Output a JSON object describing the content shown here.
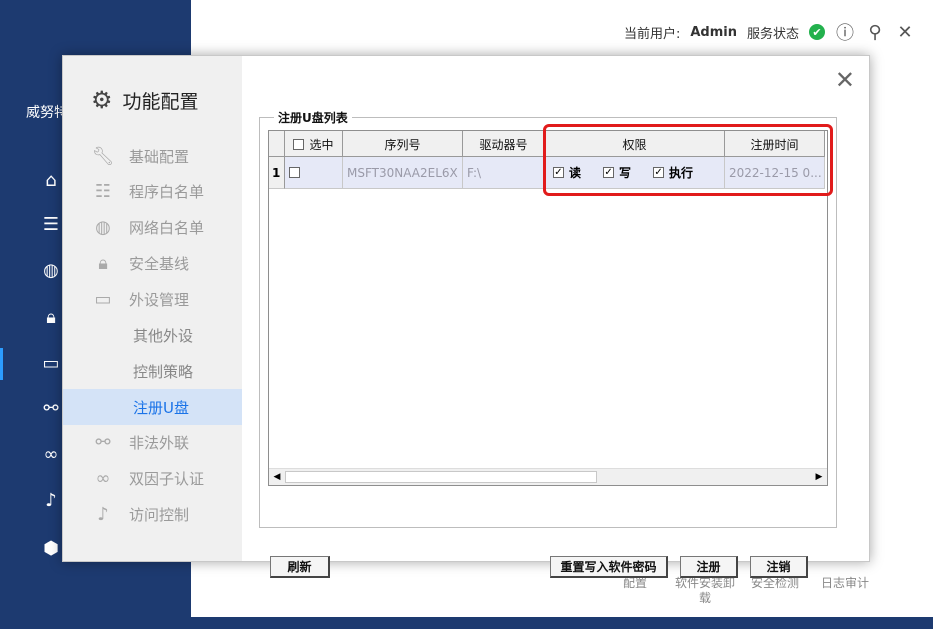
{
  "app": {
    "brand": "威努特",
    "current_user_label": "当前用户:",
    "current_user": "Admin",
    "service_status_label": "服务状态"
  },
  "bottom_tabs": [
    "配置",
    "软件安装卸载",
    "安全检测",
    "日志审计"
  ],
  "dialog": {
    "title": "功能配置",
    "nav": [
      {
        "label": "基础配置",
        "icon": "wrench-icon"
      },
      {
        "label": "程序白名单",
        "icon": "program-list-icon"
      },
      {
        "label": "网络白名单",
        "icon": "globe-icon"
      },
      {
        "label": "安全基线",
        "icon": "lock-icon"
      },
      {
        "label": "外设管理",
        "icon": "monitor-icon"
      },
      {
        "label": "其他外设",
        "icon": ""
      },
      {
        "label": "控制策略",
        "icon": ""
      },
      {
        "label": "注册U盘",
        "icon": ""
      },
      {
        "label": "非法外联",
        "icon": "broken-link-icon"
      },
      {
        "label": "双因子认证",
        "icon": "double-ring-icon"
      },
      {
        "label": "访问控制",
        "icon": "microphone-icon"
      }
    ],
    "active_nav": "注册U盘",
    "group_title": "注册U盘列表",
    "table": {
      "headers": [
        "选中",
        "序列号",
        "驱动器号",
        "权限",
        "注册时间"
      ],
      "rows": [
        {
          "num": "1",
          "serial": "MSFT30NAA2EL6X",
          "drive": "F:\\",
          "perm_read": "读",
          "perm_write": "写",
          "perm_exec": "执行",
          "time": "2022-12-15 0..."
        }
      ]
    },
    "buttons": {
      "refresh": "刷新",
      "reset_password": "重置写入软件密码",
      "register": "注册",
      "unregister": "注销"
    }
  },
  "colors": {
    "sidebar": "#1d3a70",
    "highlight": "#e11b1b",
    "active_nav": "#d4e3f7",
    "status_ok": "#23b14d"
  }
}
